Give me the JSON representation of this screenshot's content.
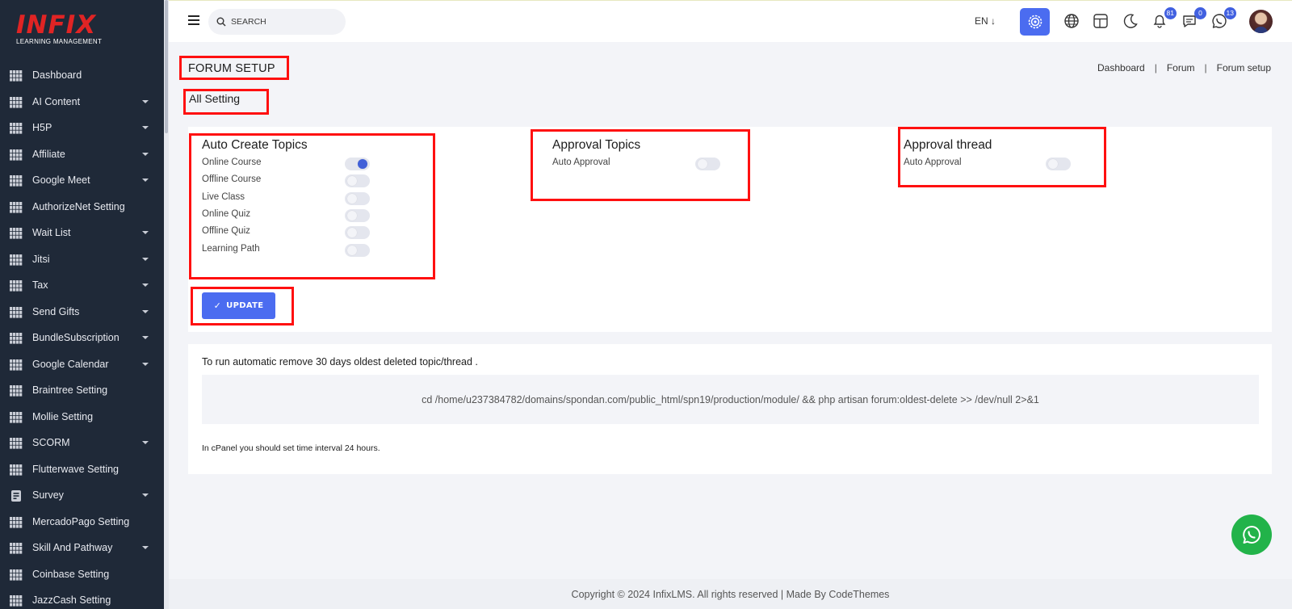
{
  "brand": {
    "logo_text": "INFIX",
    "logo_sub": "LEARNING MANAGEMENT"
  },
  "sidebar": {
    "items": [
      {
        "label": "Dashboard",
        "icon": "grid-icon",
        "has_submenu": false
      },
      {
        "label": "AI Content",
        "icon": "grid-icon",
        "has_submenu": true
      },
      {
        "label": "H5P",
        "icon": "grid-icon",
        "has_submenu": true
      },
      {
        "label": "Affiliate",
        "icon": "grid-icon",
        "has_submenu": true
      },
      {
        "label": "Google Meet",
        "icon": "grid-icon",
        "has_submenu": true
      },
      {
        "label": "AuthorizeNet Setting",
        "icon": "grid-icon",
        "has_submenu": false
      },
      {
        "label": "Wait List",
        "icon": "grid-icon",
        "has_submenu": true
      },
      {
        "label": "Jitsi",
        "icon": "grid-icon",
        "has_submenu": true
      },
      {
        "label": "Tax",
        "icon": "grid-icon",
        "has_submenu": true
      },
      {
        "label": "Send Gifts",
        "icon": "grid-icon",
        "has_submenu": true
      },
      {
        "label": "BundleSubscription",
        "icon": "grid-icon",
        "has_submenu": true
      },
      {
        "label": "Google Calendar",
        "icon": "grid-icon",
        "has_submenu": true
      },
      {
        "label": "Braintree Setting",
        "icon": "grid-icon",
        "has_submenu": false
      },
      {
        "label": "Mollie Setting",
        "icon": "grid-icon",
        "has_submenu": false
      },
      {
        "label": "SCORM",
        "icon": "grid-icon",
        "has_submenu": true
      },
      {
        "label": "Flutterwave Setting",
        "icon": "grid-icon",
        "has_submenu": false
      },
      {
        "label": "Survey",
        "icon": "survey-icon",
        "has_submenu": true
      },
      {
        "label": "MercadoPago Setting",
        "icon": "grid-icon",
        "has_submenu": false
      },
      {
        "label": "Skill And Pathway",
        "icon": "grid-icon",
        "has_submenu": true
      },
      {
        "label": "Coinbase Setting",
        "icon": "grid-icon",
        "has_submenu": false
      },
      {
        "label": "JazzCash Setting",
        "icon": "grid-icon",
        "has_submenu": false
      }
    ]
  },
  "topbar": {
    "search_placeholder": "SEARCH",
    "language": "EN",
    "notifications_count": "81",
    "messages_count": "0",
    "chat_count": "13"
  },
  "page": {
    "title": "FORUM SETUP",
    "subtitle": "All Setting",
    "breadcrumb": [
      "Dashboard",
      "Forum",
      "Forum setup"
    ]
  },
  "settings": {
    "auto_create": {
      "title": "Auto Create Topics",
      "options": [
        {
          "label": "Online Course",
          "enabled": true
        },
        {
          "label": "Offline Course",
          "enabled": false
        },
        {
          "label": "Live Class",
          "enabled": false
        },
        {
          "label": "Online Quiz",
          "enabled": false
        },
        {
          "label": "Offline Quiz",
          "enabled": false
        },
        {
          "label": "Learning Path",
          "enabled": false
        }
      ]
    },
    "approval_topics": {
      "title": "Approval Topics",
      "options": [
        {
          "label": "Auto Approval",
          "enabled": false
        }
      ]
    },
    "approval_thread": {
      "title": "Approval thread",
      "options": [
        {
          "label": "Auto Approval",
          "enabled": false
        }
      ]
    },
    "update_label": "UPDATE"
  },
  "cron": {
    "info": "To run automatic remove 30 days oldest deleted topic/thread .",
    "command": "cd /home/u237384782/domains/spondan.com/public_html/spn19/production/module/ && php artisan forum:oldest-delete >> /dev/null 2>&1",
    "note": "In cPanel you should set time interval 24 hours."
  },
  "footer": {
    "text": "Copyright © 2024 InfixLMS. All rights reserved | Made By CodeThemes"
  },
  "colors": {
    "sidebar_bg": "#1f2938",
    "accent": "#4b6cf0",
    "logo_red": "#e02424",
    "whatsapp_green": "#22b34a",
    "highlight_red": "#ff1010"
  }
}
